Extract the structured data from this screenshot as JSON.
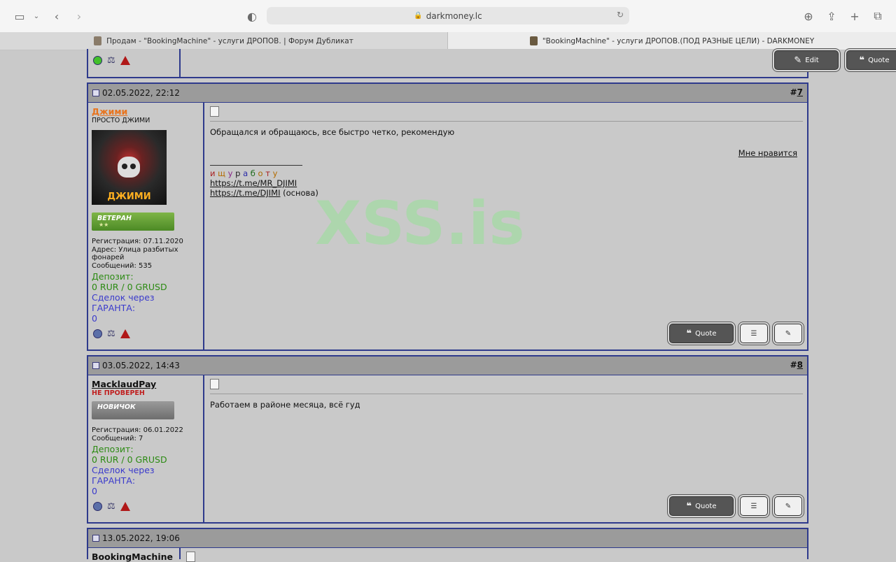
{
  "browser": {
    "address": "darkmoney.lc",
    "tabs": [
      "Продам - \"BookingMachine\" - услуги ДРОПОВ. | Форум Дубликат",
      "\"BookingMachine\" - услуги ДРОПОВ.(ПОД РАЗНЫЕ ЦЕЛИ) - DARKMONEY"
    ]
  },
  "top_buttons": {
    "edit": "Edit",
    "quote": "Quote"
  },
  "watermark": "XSS.is",
  "posts": [
    {
      "date": "02.05.2022, 22:12",
      "number_prefix": "#",
      "number": "7",
      "username": "Джими",
      "user_title": "ПРОСТО ДЖИМИ",
      "avatar_text": "ДЖИМИ",
      "rank": "ВЕТЕРАН",
      "registration": "Регистрация: 07.11.2020",
      "address": "Адрес: Улица разбитых фонарей",
      "messages": "Сообщений: 535",
      "deposit_label": "Депозит:",
      "deposit_value": "0 RUR / 0 GRUSD",
      "deals_label": "Сделок через ГАРАНТА:",
      "deals_value": "0",
      "text": "Обращался и обращаюсь, все быстро четко, рекомендую",
      "like": "Мне нравится",
      "signature_colored": [
        "и",
        "щ",
        "у",
        "р",
        "а",
        "б",
        "о",
        "т",
        "у"
      ],
      "links": [
        "https://t.me/MR_DJIMI",
        "https://t.me/DJIMI"
      ],
      "link2_suffix": " (основа)",
      "quote_button": "Quote"
    },
    {
      "date": "03.05.2022, 14:43",
      "number_prefix": "#",
      "number": "8",
      "username": "MacklaudPay",
      "user_title": "НЕ ПРОВЕРЕН",
      "rank": "НОВИЧОК",
      "registration": "Регистрация: 06.01.2022",
      "messages": "Сообщений: 7",
      "deposit_label": "Депозит:",
      "deposit_value": "0 RUR / 0 GRUSD",
      "deals_label": "Сделок через ГАРАНТА:",
      "deals_value": "0",
      "text": "Работаем в районе месяца, всё гуд",
      "quote_button": "Quote"
    },
    {
      "date": "13.05.2022, 19:06",
      "username": "BookingMachine"
    }
  ],
  "colors": {
    "border": "#2e3a8c",
    "header": "#9b9b9b",
    "deposit": "#2b8a12",
    "deals": "#3a3acc",
    "nick_orange": "#e8741e"
  }
}
